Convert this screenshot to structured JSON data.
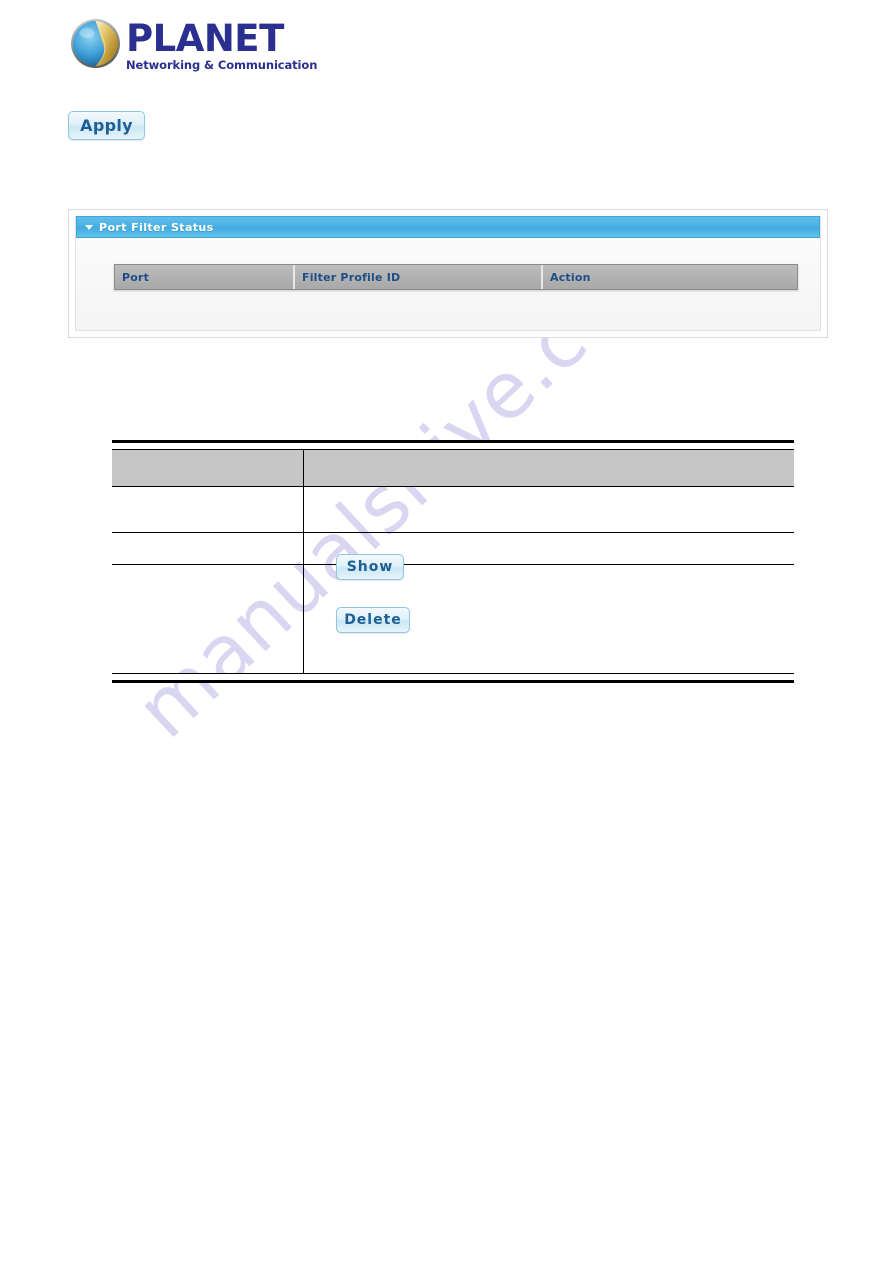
{
  "branding": {
    "name": "PLANET",
    "tagline": "Networking & Communication",
    "logo_icon": "globe-icon",
    "wordmark_color": "#2b2f8f"
  },
  "watermark": {
    "text": "manualshive.com",
    "color": "#b9b6e6"
  },
  "toolbar": {
    "apply_label": "Apply"
  },
  "port_filter_panel": {
    "title": "Port Filter Status",
    "collapse_icon": "triangle-down-icon",
    "header_color": "#49b0e5",
    "table": {
      "columns": [
        "Port",
        "Filter Profile ID",
        "Action"
      ],
      "rows": []
    }
  },
  "description_table": {
    "header": [
      "",
      ""
    ],
    "rows": [
      {
        "label": "",
        "description": ""
      },
      {
        "label": "",
        "description": ""
      },
      {
        "label": "",
        "description": ""
      }
    ],
    "buttons": {
      "show_label": "Show",
      "delete_label": "Delete"
    }
  }
}
